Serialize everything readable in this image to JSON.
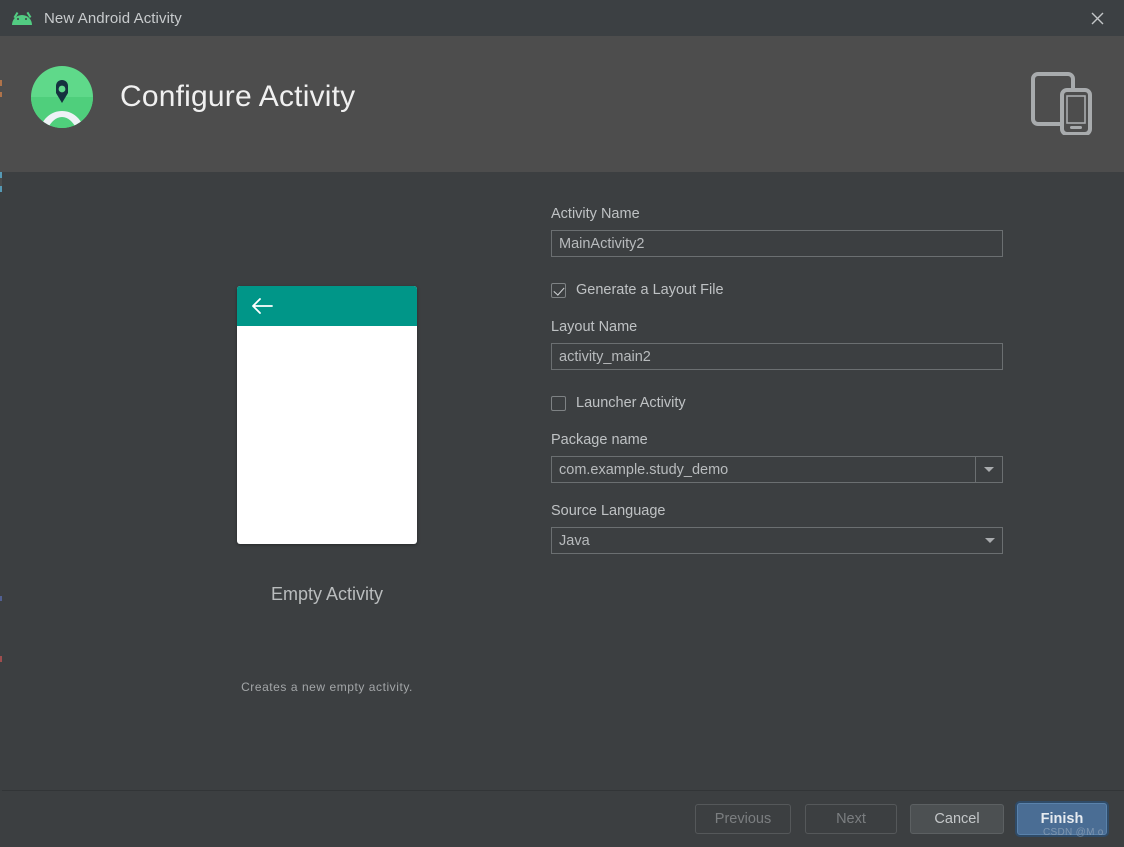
{
  "window": {
    "title": "New Android Activity",
    "app_icon": "android-robot-icon",
    "close_icon": "close-icon"
  },
  "header": {
    "title": "Configure Activity",
    "logo_icon": "android-studio-logo-icon",
    "device_icon": "tablet-and-phone-icon"
  },
  "preview": {
    "template_name": "Empty Activity",
    "description": "Creates a new empty activity.",
    "appbar_color": "#009688",
    "back_icon": "back-arrow-icon"
  },
  "form": {
    "activity_name": {
      "label": "Activity Name",
      "value": "MainActivity2",
      "placeholder": "Activity Name"
    },
    "generate_layout": {
      "label": "Generate a Layout File",
      "checked": true
    },
    "layout_name": {
      "label": "Layout Name",
      "value": "activity_main2",
      "placeholder": "Layout Name"
    },
    "launcher_activity": {
      "label": "Launcher Activity",
      "checked": false
    },
    "package_name": {
      "label": "Package name",
      "value": "com.example.study_demo",
      "dropdown_icon": "chevron-down-icon"
    },
    "source_language": {
      "label": "Source Language",
      "value": "Java",
      "dropdown_icon": "chevron-down-icon"
    }
  },
  "footer": {
    "previous_label": "Previous",
    "next_label": "Next",
    "cancel_label": "Cancel",
    "finish_label": "Finish"
  },
  "watermark": {
    "text": "CSDN @M o"
  },
  "colors": {
    "titlebar_bg": "#3c4043",
    "header_bg": "#4d4d4d",
    "body_bg": "#3c3f41",
    "accent_teal": "#009688",
    "primary_button": "#4a6d94",
    "android_green": "#52cc82"
  }
}
